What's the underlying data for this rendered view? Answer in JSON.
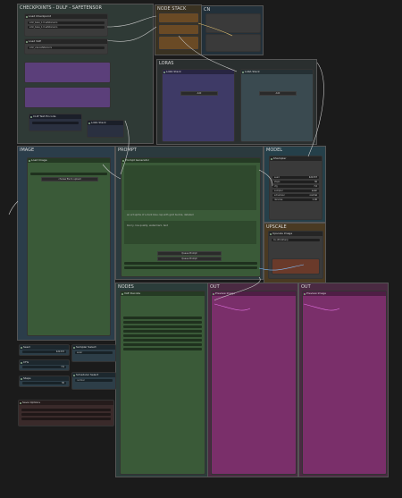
{
  "groups": {
    "checkpoints": "CHECKPOINTS - DULF - SAFETENSOR",
    "image": "IMAGE",
    "prompt": "PROMPT",
    "model": "MODEL",
    "upscale": "UPSCALE",
    "nodes": "NODES",
    "out1": "OUT",
    "out2": "OUT",
    "loras": "LORAS",
    "controlnet": "NODE STACK",
    "cn": "CN"
  },
  "nodes": {
    "load_checkpoint": "Load Checkpoint",
    "load_vae": "Load VAE",
    "lora_stack": "LoRA Stack",
    "clip_text": "CLIP Text Encode",
    "load_image": "Load Image",
    "prompt_main": "Prompt Generator",
    "model_sampler": "KSampler",
    "upscale_node": "Upscale Image",
    "vae_decode": "VAE Decode",
    "preview_1": "Preview Image",
    "preview_2": "Preview Image",
    "seed": "Seed",
    "cfg": "CFG",
    "steps": "Steps",
    "width": "Width",
    "sampler": "Sampler Select",
    "scheduler": "Scheduler Select",
    "save_options": "Save Options"
  },
  "widgets": {
    "ckpt_name": "sdxl_base_1.0.safetensors",
    "vae_name": "sdxl_vae.safetensors",
    "image_upload": "choose file to upload",
    "prompt_text": "an art sprite of a dark blue cap with gold buckle, detailed",
    "negative_text": "blurry, low quality, watermark, text",
    "seed_val": "421337",
    "cfg_val": "7.0",
    "steps_val": "30",
    "width_val": "1024",
    "sampler_val": "euler",
    "scheduler_val": "normal",
    "denoise_val": "1.00",
    "upscale_model": "4x-UltraSharp",
    "queue_button": "Queue Prompt",
    "add_button": "Add",
    "save_label": "Save"
  },
  "colors": {
    "purple_node": "#5b3f7a",
    "green_node": "#3f5a3a",
    "teal_node": "#2f4f5a",
    "magenta_node": "#7a2f6a",
    "orange_node": "#6a4a25"
  }
}
